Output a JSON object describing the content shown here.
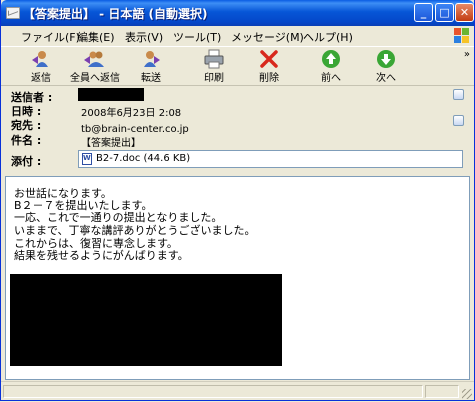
{
  "window": {
    "title": "【答案提出】 - 日本語 (自動選択)"
  },
  "titlebar_buttons": {
    "minimize": "_",
    "maximize": "□",
    "close": "✕"
  },
  "menu": [
    "ファイル(F)",
    "編集(E)",
    "表示(V)",
    "ツール(T)",
    "メッセージ(M)",
    "ヘルプ(H)"
  ],
  "toolbar": [
    {
      "label": "返信",
      "icon": "reply-icon"
    },
    {
      "label": "全員へ返信",
      "icon": "reply-all-icon"
    },
    {
      "label": "転送",
      "icon": "forward-icon"
    },
    {
      "label": "印刷",
      "icon": "print-icon"
    },
    {
      "label": "削除",
      "icon": "delete-icon"
    },
    {
      "label": "前へ",
      "icon": "previous-icon"
    },
    {
      "label": "次へ",
      "icon": "next-icon"
    }
  ],
  "toolbar_overflow": "»",
  "header": {
    "from_label": "送信者 :",
    "date_label": "日時 :",
    "date_value": "2008年6月23日 2:08",
    "to_label": "宛先 :",
    "to_value": "tb@brain-center.co.jp",
    "subject_label": "件名 :",
    "subject_value": "【答案提出】",
    "attach_label": "添付 :",
    "attach_value": "B2-7.doc (44.6 KB)"
  },
  "body_lines": [
    "お世話になります。",
    "B２－７を提出いたします。",
    "一応、これで一通りの提出となりました。",
    "いままで、丁寧な講評ありがとうございました。",
    "これからは、復習に専念します。",
    "結果を残せるようにがんばります。"
  ],
  "colors": {
    "titlebar": "#0447c9",
    "accent_green": "#3aa635",
    "delete_red": "#d8281c"
  }
}
